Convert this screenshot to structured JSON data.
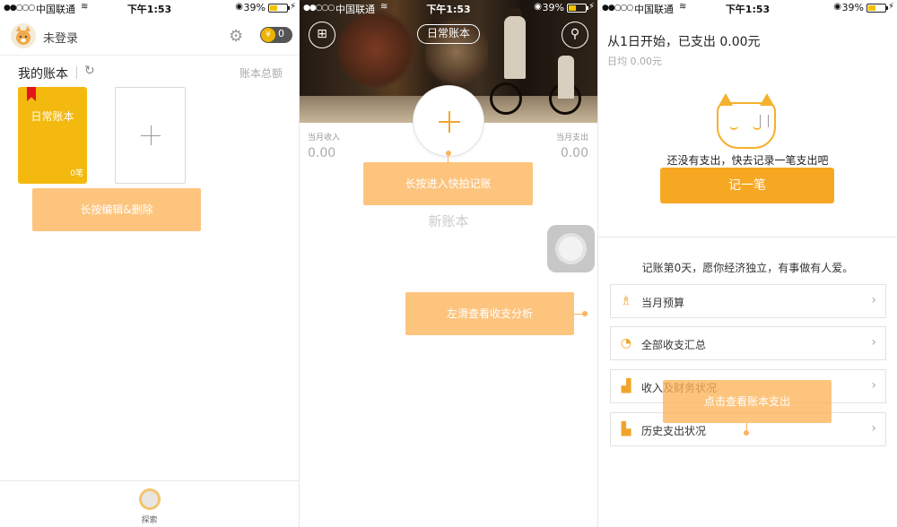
{
  "status_bar": {
    "signal": "●●○○○",
    "carrier": "中国联通",
    "time": "下午1:53",
    "battery": "39%"
  },
  "screen1": {
    "user_label": "未登录",
    "coin_count": "0",
    "section_title": "我的账本",
    "total_link": "账本总额",
    "book": {
      "name": "日常账本",
      "count": "0笔"
    },
    "hint": "长按编辑&删除",
    "tab_explore": "探索"
  },
  "screen2": {
    "book_name": "日常账本",
    "income_label": "当月收入",
    "income_value": "0.00",
    "expense_label": "当月支出",
    "expense_value": "0.00",
    "hint_quick": "长按进入快拍记账",
    "new_book": "新账本",
    "hint_swipe": "左滑查看收支分析"
  },
  "screen3": {
    "title": "从1日开始，已支出 0.00元",
    "daily": "日均 0.00元",
    "empty_message": "还没有支出，快去记录一笔支出吧",
    "record_button": "记一笔",
    "slogan": "记账第0天，愿你经济独立，有事做有人爱。",
    "menu": [
      {
        "label": "当月预算",
        "icon": "budget-icon"
      },
      {
        "label": "全部收支汇总",
        "icon": "pie-icon"
      },
      {
        "label": "收入及财务状况",
        "icon": "bar-up-icon"
      },
      {
        "label": "历史支出状况",
        "icon": "bar-icon"
      }
    ],
    "hint_tap": "点击查看账本支出"
  },
  "colors": {
    "accent": "#f6a823",
    "book_yellow": "#f3b90f",
    "hint": "#fdb45a",
    "bookmark_red": "#e4141d"
  }
}
